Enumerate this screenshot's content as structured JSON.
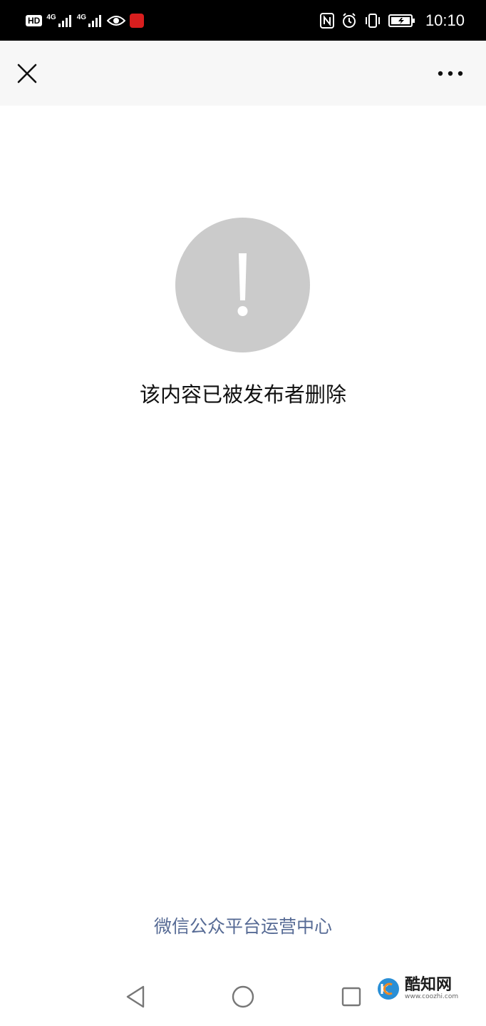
{
  "status_bar": {
    "hd_label": "HD",
    "network_1_label": "4G",
    "network_2_label": "4G",
    "time": "10:10",
    "icons": [
      "hd-icon",
      "signal-icon",
      "eye-icon",
      "app-icon",
      "nfc-icon",
      "alarm-icon",
      "vibrate-icon",
      "battery-icon"
    ]
  },
  "nav": {
    "close_icon": "close-icon",
    "more_icon": "more-icon"
  },
  "content": {
    "message": "该内容已被发布者删除",
    "alert_icon": "exclamation-icon"
  },
  "footer": {
    "link_text": "微信公众平台运营中心"
  },
  "watermark": {
    "brand": "酷知网",
    "url": "www.coozhi.com"
  },
  "colors": {
    "status_bar_bg": "#000000",
    "nav_bg": "#f7f7f7",
    "alert_circle": "#cbcbcb",
    "link": "#576b95",
    "text": "#111111"
  }
}
